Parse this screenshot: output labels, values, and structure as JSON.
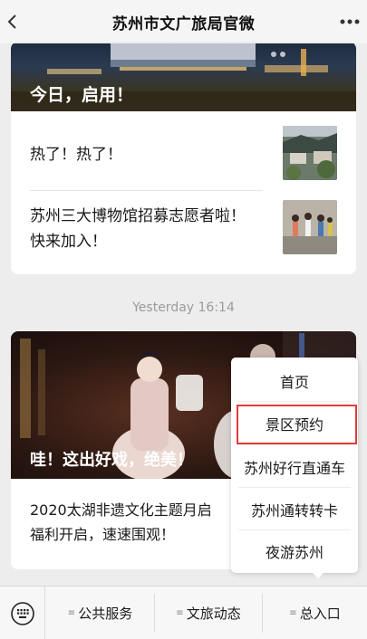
{
  "header": {
    "title": "苏州市文广旅局官微"
  },
  "card1": {
    "hero_caption": "今日，启用！",
    "items": [
      {
        "label": "热了！热了！"
      },
      {
        "label_line1": "苏州三大博物馆招募志愿者啦！",
        "label_line2": "快来加入！"
      }
    ]
  },
  "timestamp": "Yesterday 16:14",
  "card2": {
    "hero_caption": "哇！这出好戏，绝美！",
    "body_line1": "2020太湖非遗文化主题月启",
    "body_line2": "福利开启，速速围观！"
  },
  "popup_menu": {
    "items": [
      "首页",
      "景区预约",
      "苏州好行直通车",
      "苏州通转转卡",
      "夜游苏州"
    ],
    "highlighted": "景区预约"
  },
  "bottom_menu": {
    "items": [
      "公共服务",
      "文旅动态",
      "总入口"
    ]
  },
  "colors": {
    "highlight_border": "#e03c3c",
    "background": "#ededed"
  }
}
